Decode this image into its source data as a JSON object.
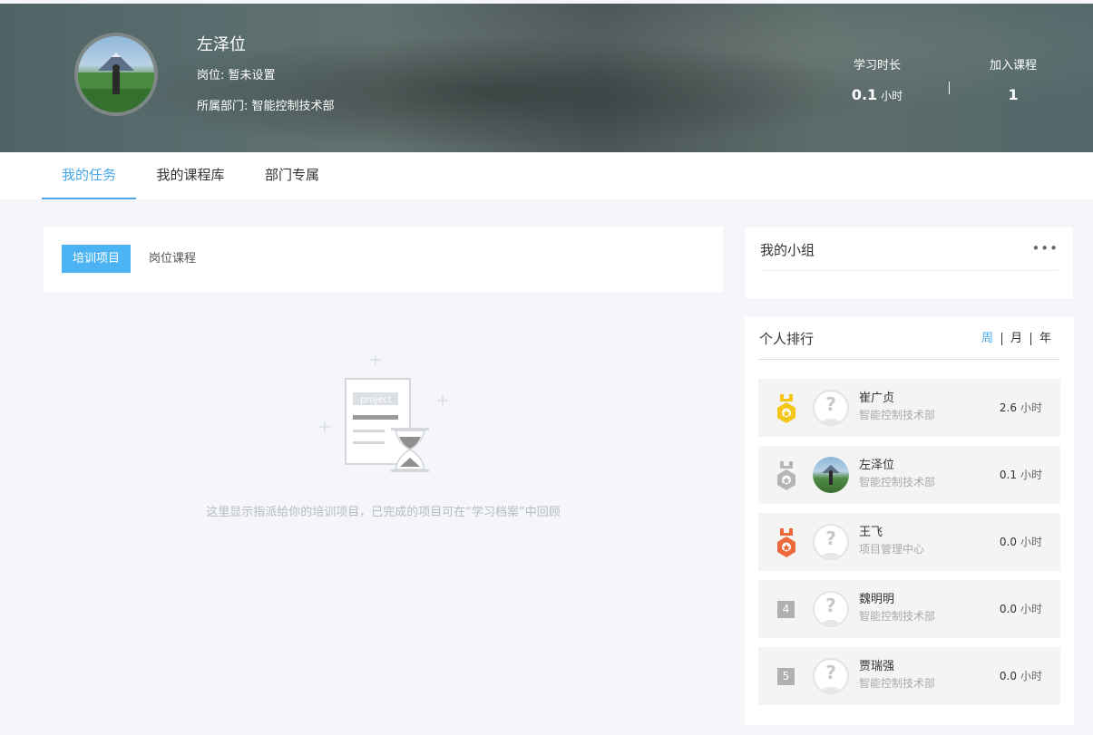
{
  "profile": {
    "name": "左泽位",
    "position": "岗位: 暂未设置",
    "department": "所属部门: 智能控制技术部"
  },
  "stats": {
    "study_time_label": "学习时长",
    "study_time_value": "0.1",
    "study_time_unit": "小时",
    "courses_label": "加入课程",
    "courses_value": "1"
  },
  "nav": {
    "tabs": [
      {
        "label": "我的任务",
        "active": true
      },
      {
        "label": "我的课程库",
        "active": false
      },
      {
        "label": "部门专属",
        "active": false
      }
    ]
  },
  "tasks": {
    "subtabs": [
      {
        "label": "培训项目",
        "active": true
      },
      {
        "label": "岗位课程",
        "active": false
      }
    ],
    "illustration_label": "project",
    "empty_text": "这里显示指派给你的培训项目，已完成的项目可在“学习档案”中回顾"
  },
  "group": {
    "title": "我的小组",
    "more": "•••"
  },
  "ranking": {
    "title": "个人排行",
    "periods": [
      {
        "label": "周",
        "active": true
      },
      {
        "label": "月",
        "active": false
      },
      {
        "label": "年",
        "active": false
      }
    ],
    "rows": [
      {
        "rank": "1",
        "medal": "gold",
        "name": "崔广贞",
        "dept": "智能控制技术部",
        "hours": "2.6",
        "unit": "小时"
      },
      {
        "rank": "2",
        "medal": "silver",
        "name": "左泽位",
        "dept": "智能控制技术部",
        "hours": "0.1",
        "unit": "小时"
      },
      {
        "rank": "3",
        "medal": "bronze",
        "name": "王飞",
        "dept": "项目管理中心",
        "hours": "0.0",
        "unit": "小时"
      },
      {
        "rank": "4",
        "medal": "",
        "name": "魏明明",
        "dept": "智能控制技术部",
        "hours": "0.0",
        "unit": "小时"
      },
      {
        "rank": "5",
        "medal": "",
        "name": "贾瑞强",
        "dept": "智能控制技术部",
        "hours": "0.0",
        "unit": "小时"
      }
    ]
  },
  "colors": {
    "accent": "#4aa8e6",
    "pill": "#4db4f3",
    "gold": "#f5c518",
    "silver": "#b5b5b5",
    "bronze": "#ee6a3c"
  }
}
